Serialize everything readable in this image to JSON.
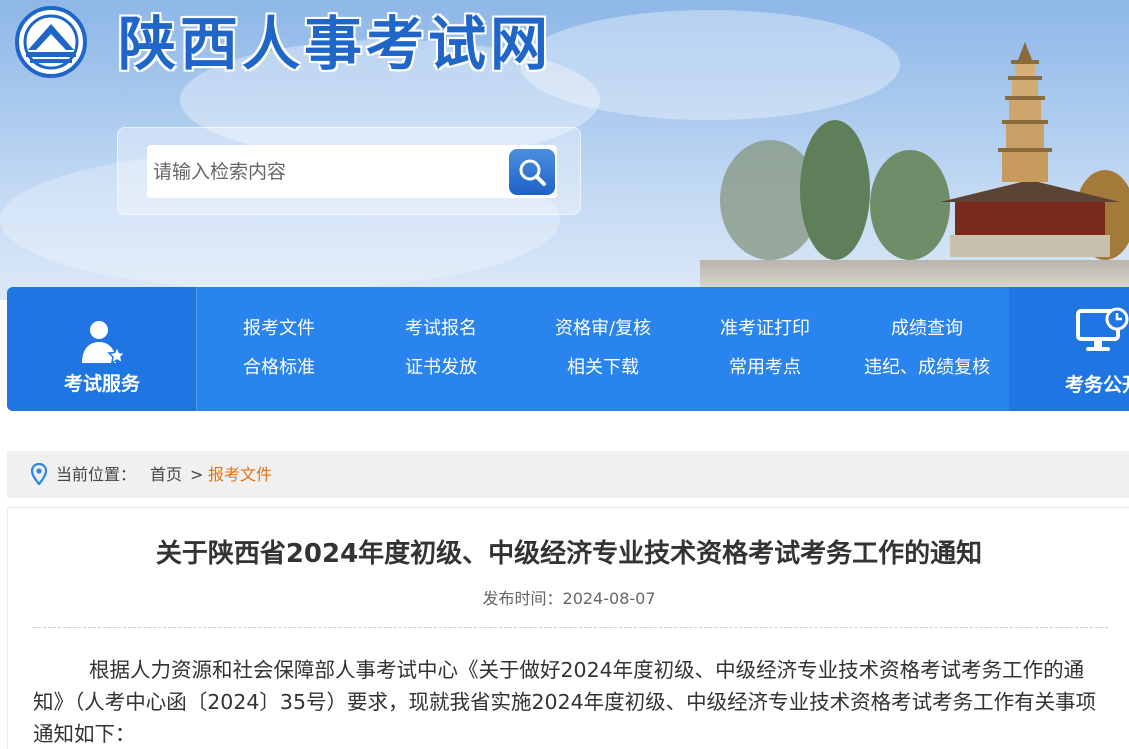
{
  "header": {
    "site_title": "陕西人事考试网",
    "search": {
      "placeholder": "请输入检索内容"
    }
  },
  "nav": {
    "service_label": "考试服务",
    "links": [
      "报考文件",
      "考试报名",
      "资格审/复核",
      "准考证打印",
      "成绩查询",
      "合格标准",
      "证书发放",
      "相关下载",
      "常用考点",
      "违纪、成绩复核"
    ],
    "right_label": "考务公开"
  },
  "breadcrumb": {
    "prefix": "当前位置：",
    "home": "首页",
    "separator": ">",
    "current": "报考文件"
  },
  "article": {
    "title": "关于陕西省2024年度初级、中级经济专业技术资格考试考务工作的通知",
    "date_label": "发布时间：",
    "date": "2024-08-07",
    "paragraph": "根据人力资源和社会保障部人事考试中心《关于做好2024年度初级、中级经济专业技术资格考试考务工作的通知》（人考中心函〔2024〕35号）要求，现就我省实施2024年度初级、中级经济专业技术资格考试考务工作有关事项通知如下："
  },
  "colors": {
    "brand_blue": "#1f66c8",
    "nav_blue": "#2a84ee",
    "breadcrumb_current": "#e6700f"
  }
}
